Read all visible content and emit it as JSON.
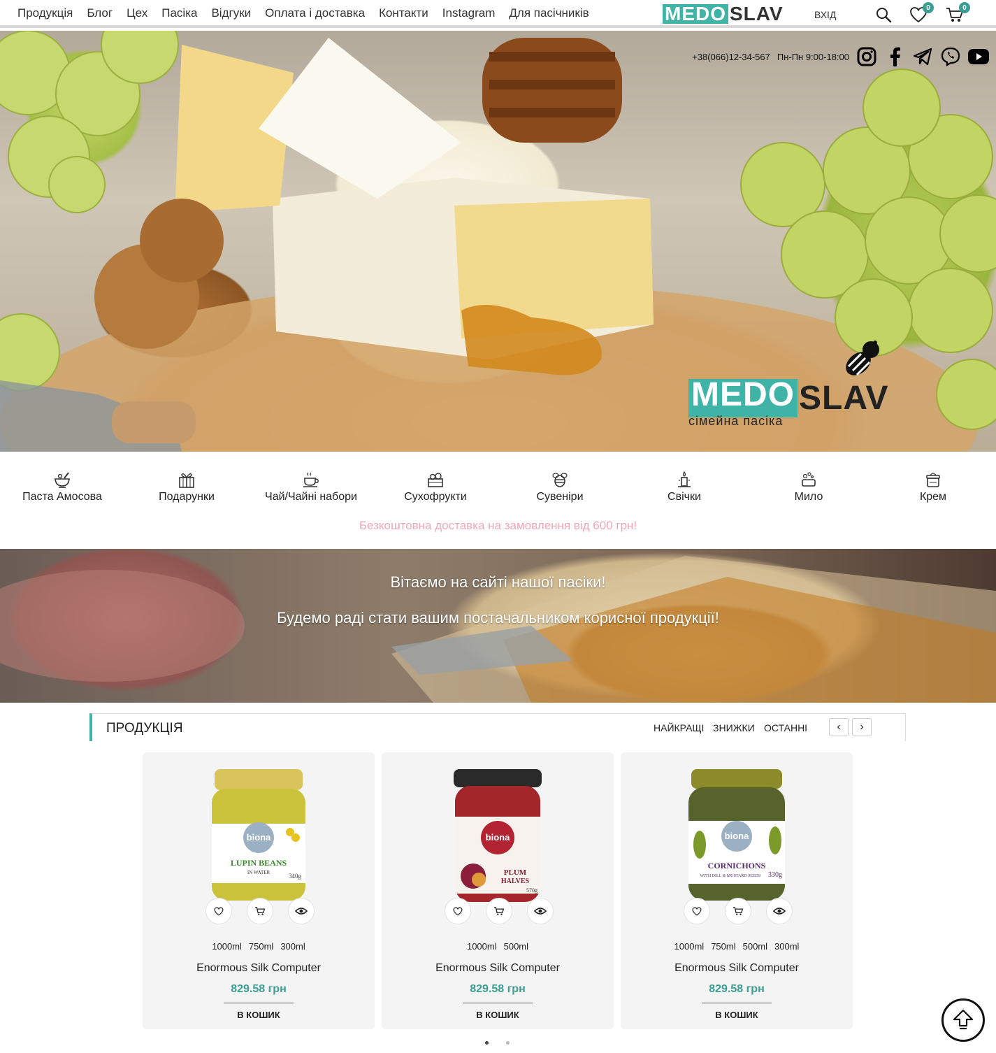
{
  "nav": {
    "items": [
      "Продукція",
      "Блог",
      "Цех",
      "Пасіка",
      "Відгуки",
      "Оплата і доставка",
      "Контакти",
      "Instagram",
      "Для пасічників"
    ]
  },
  "header": {
    "logo_part1": "MEDO",
    "logo_part2": "SLAV",
    "login": "вхід",
    "wishlist_count": "0",
    "cart_count": "0"
  },
  "hero": {
    "phone": "+38(066)12-34-567",
    "hours": "Пн-Пн 9:00-18:00",
    "socials": [
      "instagram-icon",
      "facebook-icon",
      "telegram-icon",
      "viber-icon",
      "youtube-icon"
    ],
    "brand_part1": "MEDO",
    "brand_part2": "SLAV",
    "brand_subtitle": "сімейна пасіка"
  },
  "categories": [
    {
      "label": "Паста Амосова",
      "icon": "mortar-icon"
    },
    {
      "label": "Подарунки",
      "icon": "gift-icon"
    },
    {
      "label": "Чай/Чайні набори",
      "icon": "teacup-icon"
    },
    {
      "label": "Сухофрукти",
      "icon": "dried-fruit-icon"
    },
    {
      "label": "Сувеніри",
      "icon": "bee-icon"
    },
    {
      "label": "Свічки",
      "icon": "candle-icon"
    },
    {
      "label": "Мило",
      "icon": "soap-icon"
    },
    {
      "label": "Крем",
      "icon": "cream-jar-icon"
    }
  ],
  "shipping_notice": "Безкоштовна доставка на замовлення від 600 грн!",
  "welcome": {
    "line1": "Вітаємо на сайті нашої пасіки!",
    "line2": "Будемо раді стати вашим постачальником корисної продукції!"
  },
  "products": {
    "title": "ПРОДУКЦІЯ",
    "tabs": [
      "НАЙКРАЩІ",
      "ЗНИЖКИ",
      "ОСТАННІ"
    ],
    "prev": "‹",
    "next": "›",
    "items": [
      {
        "sizes": [
          "1000ml",
          "750ml",
          "300ml"
        ],
        "name": "Enormous Silk Computer",
        "price": "829.58 грн",
        "button": "в кошик",
        "jar_brand": "biona",
        "jar_label": "LUPIN BEANS",
        "jar_sub": "IN WATER",
        "jar_weight": "340g",
        "lid_color": "#d8c45a",
        "content_color": "#c9c23a"
      },
      {
        "sizes": [
          "1000ml",
          "500ml"
        ],
        "name": "Enormous Silk Computer",
        "price": "829.58 грн",
        "button": "в кошик",
        "jar_brand": "biona",
        "jar_label": "PLUM",
        "jar_sub": "HALVES",
        "jar_weight": "570g",
        "lid_color": "#2a2a2a",
        "content_color": "#a3262b"
      },
      {
        "sizes": [
          "1000ml",
          "750ml",
          "500ml",
          "300ml"
        ],
        "name": "Enormous Silk Computer",
        "price": "829.58 грн",
        "button": "в кошик",
        "jar_brand": "biona",
        "jar_label": "CORNICHONS",
        "jar_sub": "WITH DILL & MUSTARD SEEDS",
        "jar_weight": "330g",
        "lid_color": "#8c8a2a",
        "content_color": "#56632a"
      }
    ]
  },
  "colors": {
    "accent": "#3fb3a6",
    "price": "#3a9e92",
    "notice": "#f2a7b8"
  }
}
